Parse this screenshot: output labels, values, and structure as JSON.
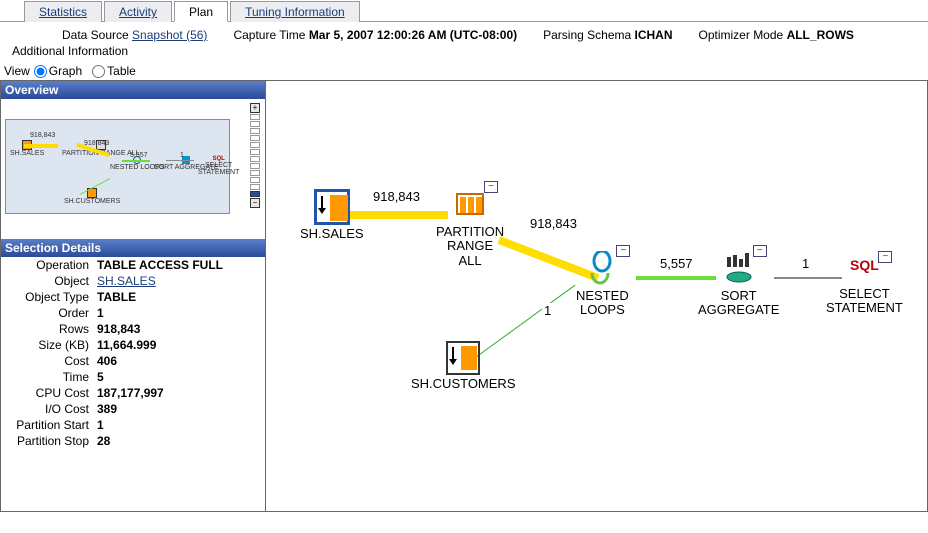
{
  "tabs": {
    "statistics": "Statistics",
    "activity": "Activity",
    "plan": "Plan",
    "tuning": "Tuning Information"
  },
  "info": {
    "data_source_label": "Data Source",
    "data_source_value": "Snapshot (56)",
    "capture_time_label": "Capture Time",
    "capture_time_value": "Mar 5, 2007 12:00:26 AM (UTC-08:00)",
    "parsing_schema_label": "Parsing Schema",
    "parsing_schema_value": "ICHAN",
    "optimizer_mode_label": "Optimizer Mode",
    "optimizer_mode_value": "ALL_ROWS",
    "additional_info_label": "Additional Information"
  },
  "view": {
    "label": "View",
    "graph": "Graph",
    "table": "Table"
  },
  "overview": {
    "title": "Overview"
  },
  "selection": {
    "title": "Selection Details",
    "rows": [
      {
        "label": "Operation",
        "value": "TABLE ACCESS FULL"
      },
      {
        "label": "Object",
        "value": "SH.SALES",
        "link": true
      },
      {
        "label": "Object Type",
        "value": "TABLE"
      },
      {
        "label": "Order",
        "value": "1"
      },
      {
        "label": "Rows",
        "value": "918,843"
      },
      {
        "label": "Size (KB)",
        "value": "11,664.999"
      },
      {
        "label": "Cost",
        "value": "406"
      },
      {
        "label": "Time",
        "value": "5"
      },
      {
        "label": "CPU Cost",
        "value": "187,177,997"
      },
      {
        "label": "I/O Cost",
        "value": "389"
      },
      {
        "label": "Partition Start",
        "value": "1"
      },
      {
        "label": "Partition Stop",
        "value": "28"
      }
    ]
  },
  "diagram": {
    "nodes": {
      "sales": "SH.SALES",
      "partition": "PARTITION\nRANGE\nALL",
      "customers": "SH.CUSTOMERS",
      "nested": "NESTED\nLOOPS",
      "sort": "SORT\nAGGREGATE",
      "select": "SELECT\nSTATEMENT",
      "sql": "SQL"
    },
    "edges": {
      "sales_partition": "918,843",
      "partition_nested": "918,843",
      "customers_nested": "1",
      "nested_sort": "5,557",
      "sort_select": "1"
    }
  },
  "minimap": {
    "val1": "918,843",
    "val2": "918,843",
    "val3": "5,557",
    "val4": "1",
    "sales": "SH.SALES",
    "customers": "SH.CUSTOMERS",
    "partition": "PARTITION RANGE ALL",
    "nested": "NESTED LOOPS",
    "sort": "SORT AGGREGATE",
    "select": "SELECT STATEMENT",
    "sql": "SQL"
  }
}
